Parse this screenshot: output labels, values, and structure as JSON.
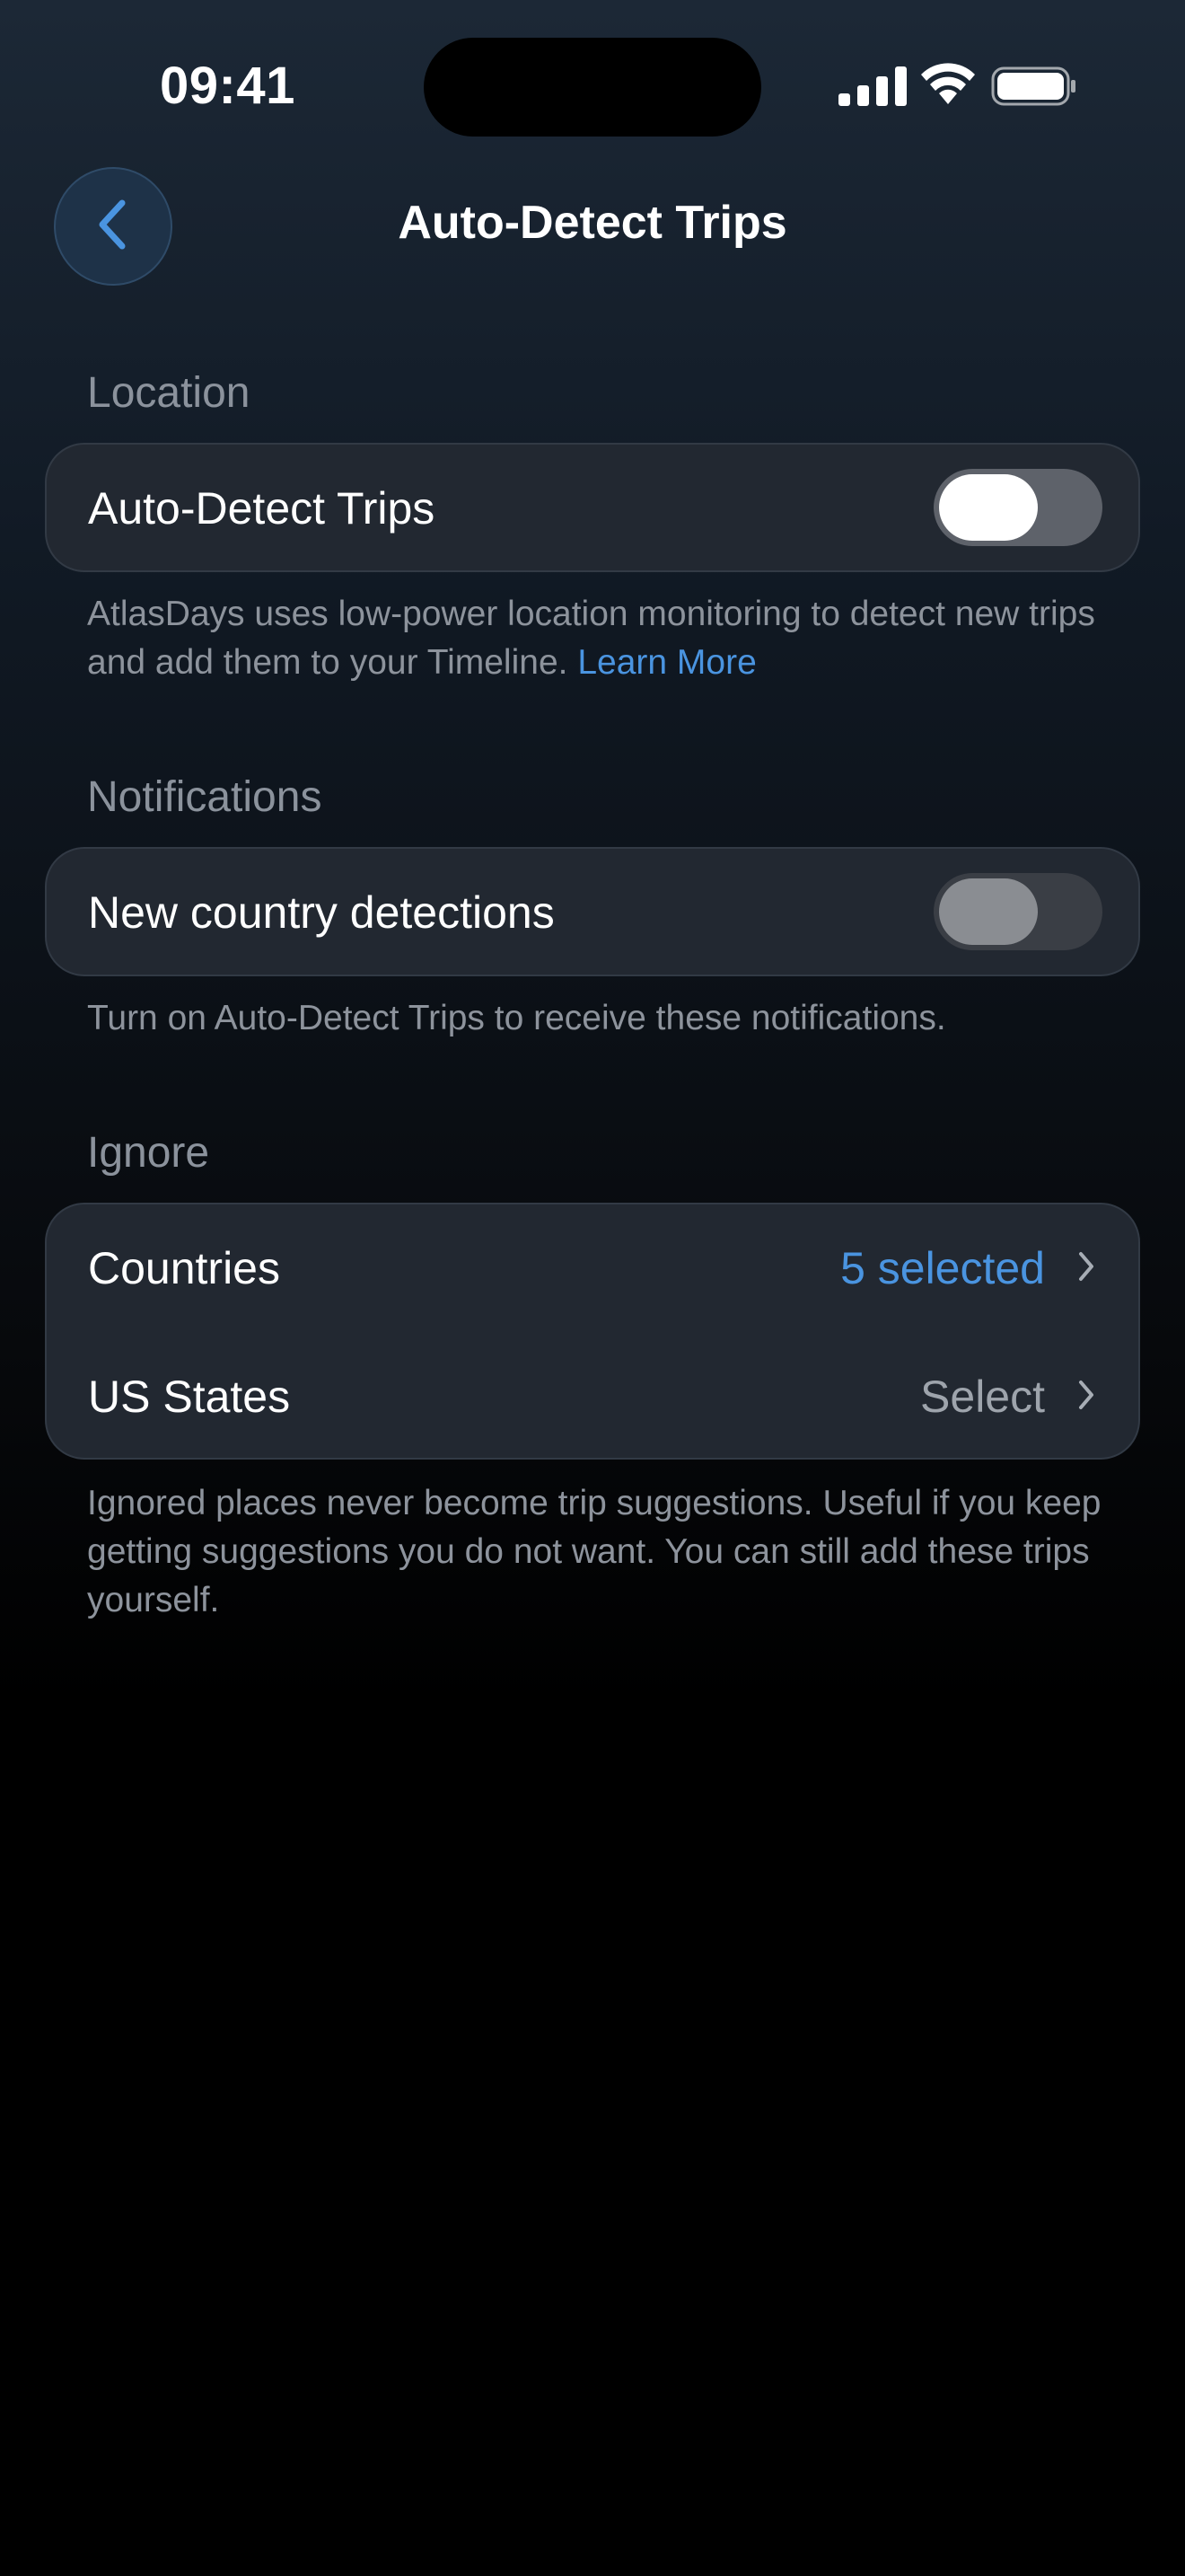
{
  "status_bar": {
    "time": "09:41",
    "icons": [
      "cellular-signal-icon",
      "wifi-icon",
      "battery-icon"
    ]
  },
  "nav": {
    "back_icon": "chevron-left-icon",
    "title": "Auto-Detect Trips"
  },
  "location": {
    "header": "Location",
    "row_label": "Auto-Detect Trips",
    "toggle_state": "on",
    "footnote": "AtlasDays uses low-power location monitoring to detect new trips and add them to your Timeline.",
    "link_text": "Learn More"
  },
  "notifications": {
    "header": "Notifications",
    "row_label": "New country detections",
    "toggle_state": "disabled",
    "footnote": "Turn on Auto-Detect Trips to receive these notifications."
  },
  "ignore": {
    "header": "Ignore",
    "rows": [
      {
        "label": "Countries",
        "value": "5 selected"
      },
      {
        "label": "US States",
        "value": "Select"
      }
    ],
    "footnote": "Ignored places never become trip suggestions. Useful if you keep getting suggestions you do not want. You can still add these trips yourself."
  },
  "colors": {
    "accent": "#4a94e0",
    "secondary_text": "#8d939c",
    "card_background": "#222831"
  }
}
